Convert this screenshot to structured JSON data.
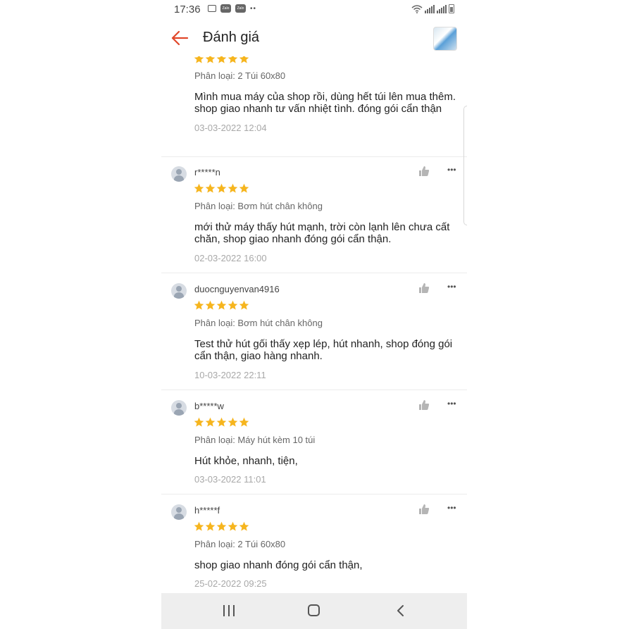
{
  "status_bar": {
    "time": "17:36",
    "zalo_label": "Zalo"
  },
  "header": {
    "title": "Đánh giá"
  },
  "star_color": "#f6b51e",
  "reviews": [
    {
      "username": "",
      "stars": 5,
      "variant": "Phân loại: 2 Túi 60x80",
      "content_lines": [
        "Mình mua máy của shop rồi, dùng hết túi lên mua thêm.",
        "shop giao nhanh tư vấn nhiệt tình. đóng gói cẩn thận"
      ],
      "date": "03-03-2022 12:04"
    },
    {
      "username": "r*****n",
      "stars": 5,
      "variant": "Phân loại: Bơm hút chân không",
      "content_lines": [
        "mới thử máy thấy hút mạnh, trời còn lạnh lên chưa cất",
        "chăn, shop giao nhanh đóng gói cẩn thận."
      ],
      "date": "02-03-2022 16:00"
    },
    {
      "username": "duocnguyenvan4916",
      "stars": 5,
      "variant": "Phân loại: Bơm hút chân không",
      "content_lines": [
        "Test thử hút gối thấy xẹp lép, hút nhanh, shop đóng gói",
        "cẩn thận, giao hàng nhanh."
      ],
      "date": "10-03-2022 22:11"
    },
    {
      "username": "b*****w",
      "stars": 5,
      "variant": "Phân loại: Máy hút kèm 10 túi",
      "content_lines": [
        "Hút khỏe, nhanh, tiện,"
      ],
      "date": "03-03-2022 11:01"
    },
    {
      "username": "h*****f",
      "stars": 5,
      "variant": "Phân loại: 2 Túi 60x80",
      "content_lines": [
        "shop giao nhanh đóng gói cẩn thận,"
      ],
      "date": "25-02-2022 09:25"
    }
  ]
}
